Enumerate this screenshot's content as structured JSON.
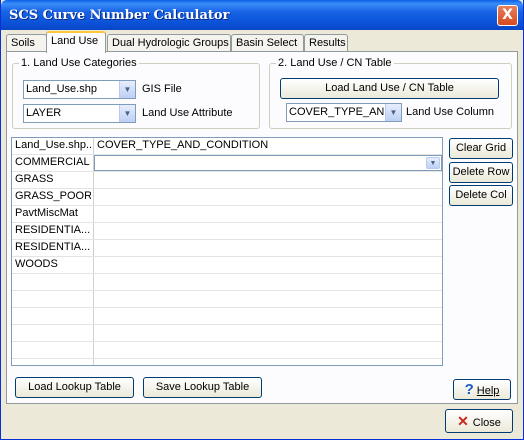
{
  "window": {
    "title": "SCS Curve Number Calculator",
    "close_glyph": "X"
  },
  "tabs": [
    {
      "label": "Soils"
    },
    {
      "label": "Land Use"
    },
    {
      "label": "Dual Hydrologic Groups"
    },
    {
      "label": "Basin Select"
    },
    {
      "label": "Results"
    }
  ],
  "land_use_categories": {
    "legend": "1. Land Use Categories",
    "gis_file_value": "Land_Use.shp",
    "gis_file_label": "GIS File",
    "attribute_value": "LAYER",
    "attribute_label": "Land Use Attribute"
  },
  "cn_table": {
    "legend": "2. Land Use / CN Table",
    "load_button": "Load Land Use / CN Table",
    "column_value": "COVER_TYPE_AND",
    "column_label": "Land Use Column"
  },
  "grid": {
    "header": [
      "Land_Use.shp...",
      "COVER_TYPE_AND_CONDITION"
    ],
    "rows": [
      "COMMERCIAL",
      "GRASS",
      "GRASS_POOR",
      "PavtMiscMat",
      "RESIDENTIA...",
      "RESIDENTIA...",
      "WOODS"
    ]
  },
  "side_buttons": {
    "clear_grid": "Clear Grid",
    "delete_row": "Delete Row",
    "delete_col": "Delete Col"
  },
  "bottom_buttons": {
    "load_lookup": "Load Lookup Table",
    "save_lookup": "Save Lookup Table",
    "help": "Help",
    "close": "Close"
  },
  "icons": {
    "help": "question-mark",
    "close": "red-x",
    "dropdown": "chevron-down"
  }
}
